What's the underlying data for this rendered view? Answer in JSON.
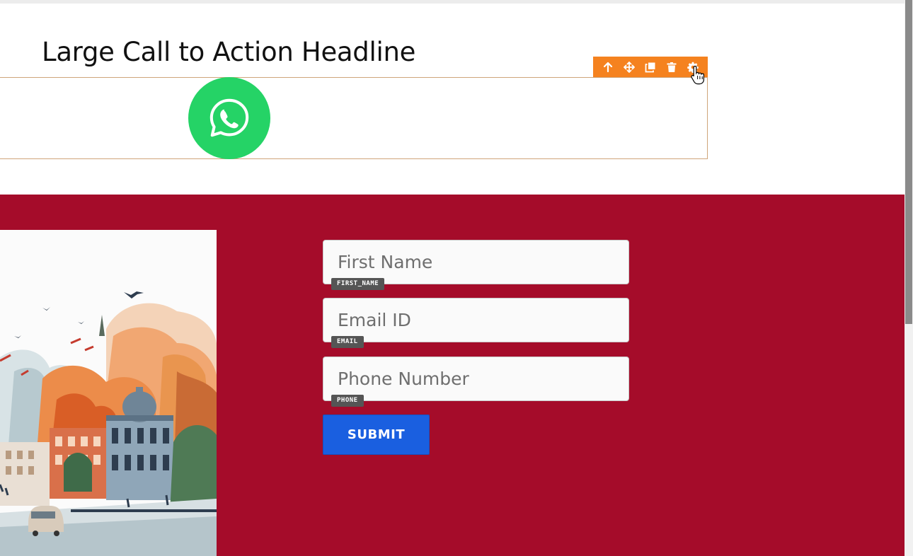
{
  "page": {
    "headline": "Large Call to Action Headline"
  },
  "toolbar": {
    "buttons": [
      {
        "name": "move-up",
        "icon": "arrow-up-icon"
      },
      {
        "name": "drag",
        "icon": "move-icon"
      },
      {
        "name": "duplicate",
        "icon": "copy-icon"
      },
      {
        "name": "delete",
        "icon": "trash-icon"
      },
      {
        "name": "settings",
        "icon": "gear-icon"
      }
    ],
    "color": "#f5821f"
  },
  "whatsapp": {
    "icon": "whatsapp-icon",
    "color": "#25d366"
  },
  "form": {
    "fields": [
      {
        "placeholder": "First Name",
        "tag": "FIRST_NAME"
      },
      {
        "placeholder": "Email ID",
        "tag": "EMAIL"
      },
      {
        "placeholder": "Phone Number",
        "tag": "PHONE"
      }
    ],
    "submit_label": "SUBMIT",
    "submit_color": "#1a5fe0"
  },
  "section": {
    "background": "#a50c2a",
    "image": "city-illustration"
  }
}
